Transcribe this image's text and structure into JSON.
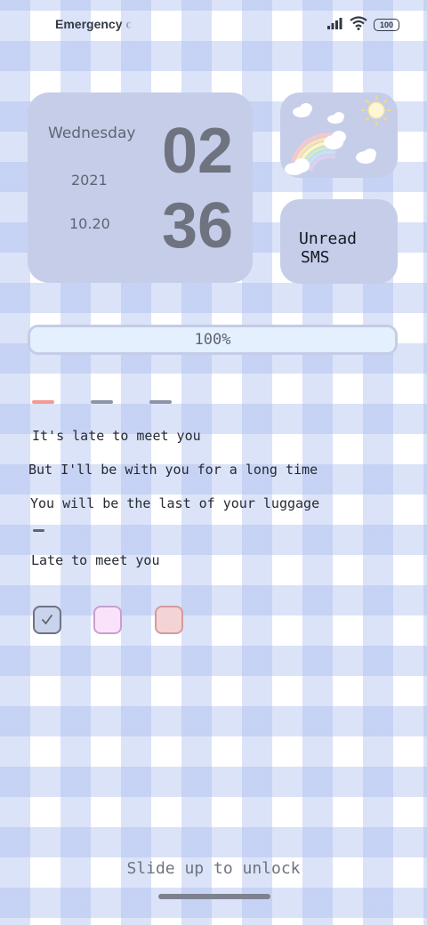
{
  "status_bar": {
    "carrier": "Emergency c",
    "battery": "100",
    "icons": [
      "signal-icon",
      "wifi-icon",
      "battery-icon"
    ]
  },
  "clock": {
    "weekday": "Wednesday",
    "year": "2021",
    "date": "10.20",
    "hour": "02",
    "minute": "36"
  },
  "weather": {
    "icons": [
      "sun-icon",
      "cloud-icon",
      "rainbow-icon"
    ]
  },
  "sms": {
    "line1": "Unread",
    "line2": "SMS"
  },
  "progress": {
    "label": "100%",
    "value": 1.0
  },
  "tabs": {
    "colors": [
      "#f39a92",
      "#8c94a6",
      "#8c94a6"
    ]
  },
  "lyrics": {
    "line1": "It's late to meet you",
    "line2": "But I'll be with you for a long time",
    "line3": "You will be the last of your luggage",
    "line4": "Late to meet you"
  },
  "checkboxes": [
    {
      "checked": true,
      "color": "#cad3ec"
    },
    {
      "checked": false,
      "color": "#fae2fb"
    },
    {
      "checked": false,
      "color": "#f4d3d4"
    }
  ],
  "lock": {
    "hint": "Slide up to unlock"
  }
}
